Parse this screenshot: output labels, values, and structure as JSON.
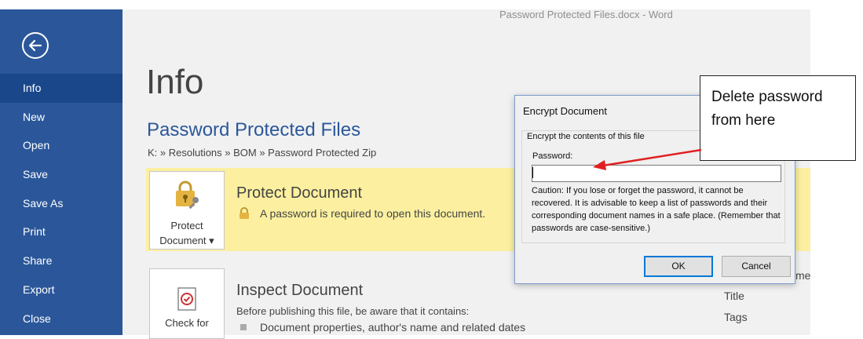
{
  "window_title": "Password Protected Files.docx  -  Word",
  "nav": {
    "items": [
      {
        "label": "Info",
        "active": true
      },
      {
        "label": "New"
      },
      {
        "label": "Open"
      },
      {
        "label": "Save"
      },
      {
        "label": "Save As"
      },
      {
        "label": "Print"
      },
      {
        "label": "Share"
      },
      {
        "label": "Export"
      },
      {
        "label": "Close"
      }
    ]
  },
  "page": {
    "title": "Info",
    "doc_name": "Password Protected Files",
    "path": "K: » Resolutions » BOM » Password Protected Zip"
  },
  "protect": {
    "tile_line1": "Protect",
    "tile_line2": "Document ▾",
    "title": "Protect Document",
    "desc": "A password is required to open this document."
  },
  "inspect": {
    "tile_line1": "Check for",
    "title": "Inspect Document",
    "desc": "Before publishing this file, be aware that it contains:",
    "bullet1": "Document properties, author's name and related dates"
  },
  "properties": {
    "partial_name": "me",
    "title_label": "Title",
    "tags_label": "Tags"
  },
  "dialog": {
    "title": "Encrypt Document",
    "group_label": "Encrypt the contents of this file",
    "password_label": "Password:",
    "password_value": "",
    "caution": "Caution: If you lose or forget the password, it cannot be recovered. It is advisable to keep a list of passwords and their corresponding document names in a safe place. (Remember that passwords are case-sensitive.)",
    "ok_label": "OK",
    "cancel_label": "Cancel"
  },
  "callout": {
    "line1": "Delete password",
    "line2": "from here"
  },
  "colors": {
    "sidebar": "#2b579a",
    "sidebar_active": "#19478a",
    "protect_band": "#fcf0a0",
    "arrow": "#e02020"
  }
}
